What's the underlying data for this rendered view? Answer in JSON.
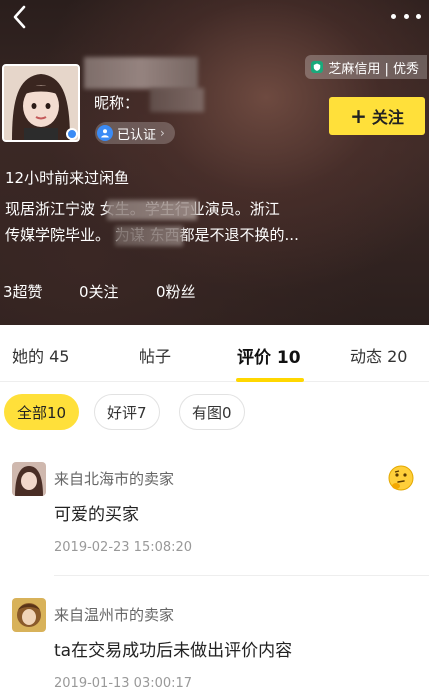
{
  "header": {
    "nickname_label": "昵称：",
    "cert_label": "已认证",
    "credit_label": "芝麻信用 | 优秀",
    "follow_label": "关注",
    "last_seen": "12小时前来过闲鱼",
    "bio_line1": "现居浙江宁波                  女生。学生行业演员。浙江",
    "bio_line2": "传媒学院毕业。             为谋 东西都是不退不换的...",
    "stats": [
      "3超赞",
      "0关注",
      "0粉丝"
    ]
  },
  "tabs": [
    {
      "label": "她的 45"
    },
    {
      "label": "帖子"
    },
    {
      "label": "评价 10"
    },
    {
      "label": "动态 20"
    }
  ],
  "filters": [
    {
      "label": "全部10"
    },
    {
      "label": "好评7"
    },
    {
      "label": "有图0"
    }
  ],
  "reviews": [
    {
      "source": "来自北海市的卖家",
      "content": "可爱的买家",
      "time": "2019-02-23 15:08:20"
    },
    {
      "source": "来自温州市的卖家",
      "content": "ta在交易成功后未做出评价内容",
      "time": "2019-01-13 03:00:17"
    }
  ],
  "colors": {
    "accent": "#ffe03a",
    "underline": "#ffd700",
    "verified": "#3b8bf5",
    "credit": "#1aa97b"
  },
  "icons": [
    "back-arrow-icon",
    "more-dots-icon",
    "verified-user-icon",
    "chevron-right-icon",
    "credit-shield-icon",
    "plus-icon",
    "thinking-face-icon"
  ]
}
